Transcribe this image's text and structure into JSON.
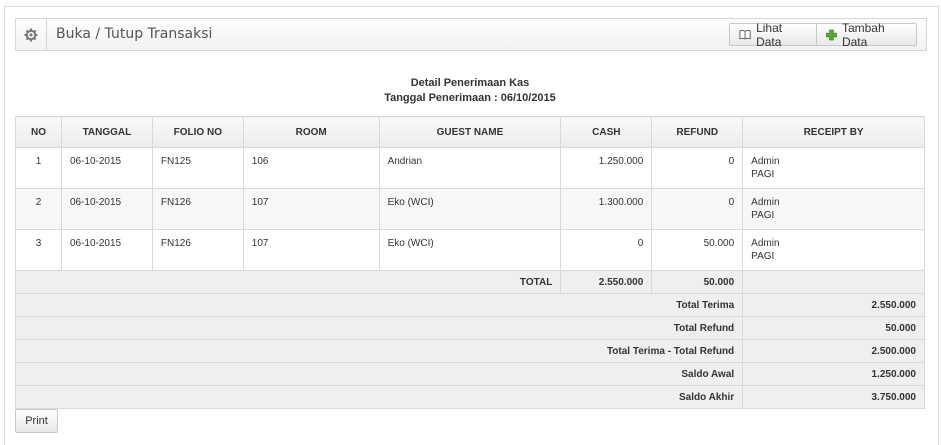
{
  "header": {
    "title": "Buka / Tutup Transaksi",
    "lihat_label": "Lihat Data",
    "tambah_label": "Tambah Data"
  },
  "caption": {
    "line1": "Detail Penerimaan Kas",
    "line2": "Tanggal Penerimaan : 06/10/2015"
  },
  "table": {
    "columns": [
      "NO",
      "TANGGAL",
      "FOLIO NO",
      "ROOM",
      "GUEST NAME",
      "CASH",
      "REFUND",
      "RECEIPT BY"
    ],
    "rows": [
      {
        "no": "1",
        "tanggal": "06-10-2015",
        "folio": "FN125",
        "room": "106",
        "guest": "Andrian",
        "cash": "1.250.000",
        "refund": "0",
        "receipt_name": "Admin",
        "receipt_shift": "PAGI"
      },
      {
        "no": "2",
        "tanggal": "06-10-2015",
        "folio": "FN126",
        "room": "107",
        "guest": "Eko (WCI)",
        "cash": "1.300.000",
        "refund": "0",
        "receipt_name": "Admin",
        "receipt_shift": "PAGI"
      },
      {
        "no": "3",
        "tanggal": "06-10-2015",
        "folio": "FN126",
        "room": "107",
        "guest": "Eko (WCI)",
        "cash": "0",
        "refund": "50.000",
        "receipt_name": "Admin",
        "receipt_shift": "PAGI"
      }
    ],
    "total_label": "TOTAL",
    "total_cash": "2.550.000",
    "total_refund": "50.000",
    "summary": [
      {
        "label": "Total Terima",
        "value": "2.550.000"
      },
      {
        "label": "Total Refund",
        "value": "50.000"
      },
      {
        "label": "Total Terima - Total Refund",
        "value": "2.500.000"
      },
      {
        "label": "Saldo Awal",
        "value": "1.250.000"
      },
      {
        "label": "Saldo Akhir",
        "value": "3.750.000"
      }
    ]
  },
  "footer": {
    "print_label": "Print"
  },
  "icons": {
    "gear": "gear-icon",
    "book": "book-icon",
    "plus": "plus-icon"
  },
  "colors": {
    "plus_green": "#5aa832"
  }
}
